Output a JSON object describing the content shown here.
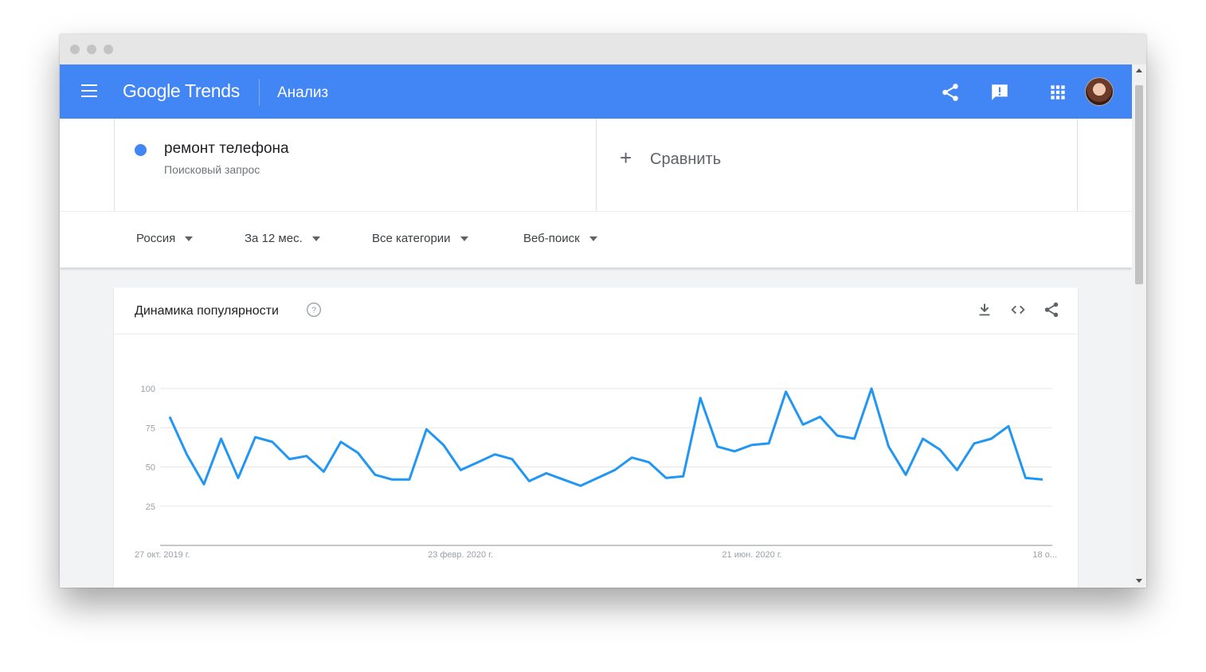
{
  "header": {
    "logo": "Google Trends",
    "title": "Анализ",
    "icons": [
      "menu-icon",
      "share-icon",
      "feedback-icon",
      "apps-icon",
      "avatar"
    ]
  },
  "search": {
    "term": "ремонт телефона",
    "term_type": "Поисковый запрос",
    "term_color": "#4285f4",
    "compare_label": "Сравнить"
  },
  "filters": {
    "region": "Россия",
    "period": "За 12 мес.",
    "category": "Все категории",
    "search_type": "Веб-поиск"
  },
  "panel": {
    "title": "Динамика популярности",
    "icons": [
      "help-icon",
      "download-icon",
      "embed-icon",
      "share-icon"
    ]
  },
  "chart_data": {
    "type": "line",
    "title": "Динамика популярности",
    "xlabel": "",
    "ylabel": "",
    "ylim": [
      0,
      100
    ],
    "yticks": [
      25,
      50,
      75,
      100
    ],
    "x_tick_labels": [
      "27 окт. 2019 г.",
      "23 февр. 2020 г.",
      "21 июн. 2020 г.",
      "18 о..."
    ],
    "grid": true,
    "series": [
      {
        "color": "#2196f3",
        "values": [
          82,
          58,
          39,
          68,
          43,
          69,
          66,
          55,
          57,
          47,
          66,
          59,
          45,
          42,
          42,
          74,
          64,
          48,
          53,
          58,
          55,
          41,
          46,
          42,
          38,
          43,
          48,
          56,
          53,
          43,
          44,
          94,
          63,
          60,
          64,
          65,
          98,
          77,
          82,
          70,
          68,
          100,
          63,
          45,
          68,
          61,
          48,
          65,
          68,
          76,
          43,
          42
        ]
      }
    ]
  }
}
